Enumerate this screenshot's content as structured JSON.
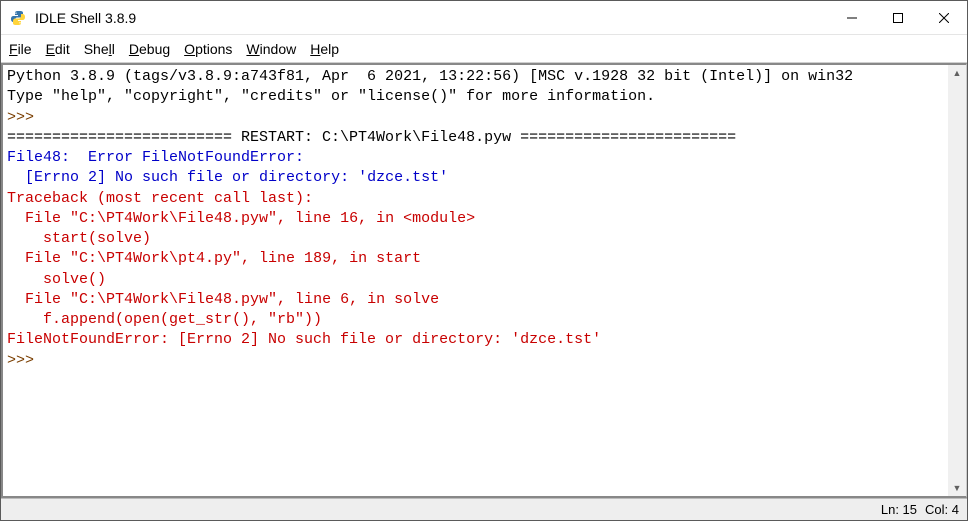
{
  "window": {
    "title": "IDLE Shell 3.8.9"
  },
  "menu": {
    "file": "File",
    "edit": "Edit",
    "shell": "Shell",
    "debug": "Debug",
    "options": "Options",
    "window": "Window",
    "help": "Help"
  },
  "console": {
    "banner_line1": "Python 3.8.9 (tags/v3.8.9:a743f81, Apr  6 2021, 13:22:56) [MSC v.1928 32 bit (Intel)] on win32",
    "banner_line2": "Type \"help\", \"copyright\", \"credits\" or \"license()\" for more information.",
    "prompt": ">>> ",
    "restart_line": "========================= RESTART: C:\\PT4Work\\File48.pyw ========================",
    "file48_err_prefix": "File48:  Error FileNotFoundError:",
    "errno_msg": "  [Errno 2] No such file or directory: 'dzce.tst'",
    "traceback_header": "Traceback (most recent call last):",
    "tb1_loc": "  File \"C:\\PT4Work\\File48.pyw\", line 16, in <module>",
    "tb1_code": "    start(solve)",
    "tb2_loc": "  File \"C:\\PT4Work\\pt4.py\", line 189, in start",
    "tb2_code": "    solve()",
    "tb3_loc": "  File \"C:\\PT4Work\\File48.pyw\", line 6, in solve",
    "tb3_code": "    f.append(open(get_str(), \"rb\"))",
    "final_error": "FileNotFoundError: [Errno 2] No such file or directory: 'dzce.tst'"
  },
  "status": {
    "ln": "Ln: 15",
    "col": "Col: 4"
  }
}
